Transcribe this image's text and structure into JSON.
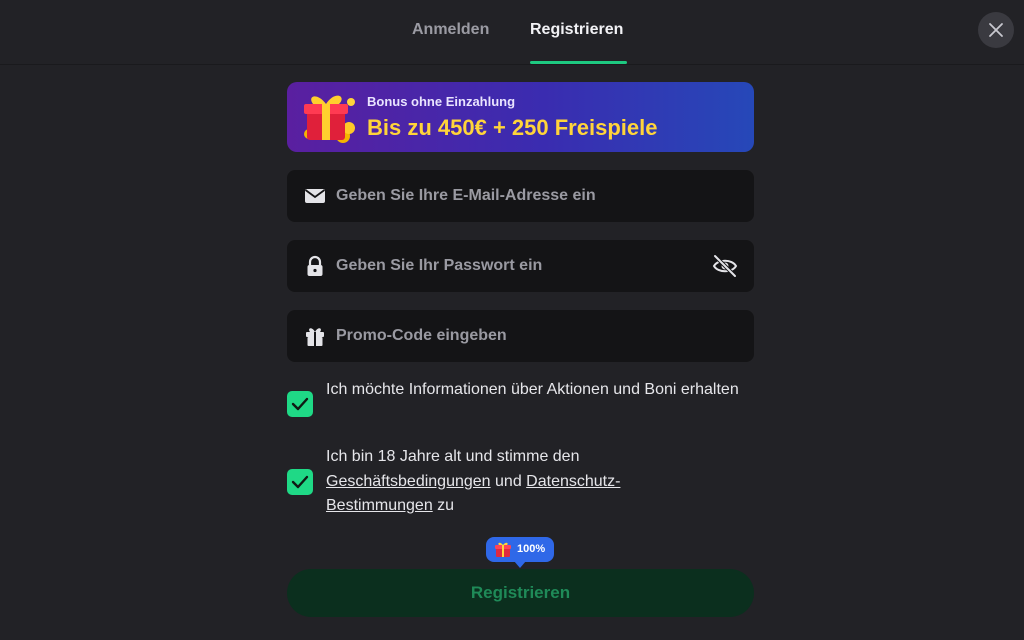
{
  "tabs": {
    "login": "Anmelden",
    "register": "Registrieren"
  },
  "banner": {
    "subtitle": "Bonus ohne Einzahlung",
    "title": "Bis zu 450€ + 250 Freispiele",
    "icon": "gift-box-icon"
  },
  "form": {
    "email": {
      "placeholder": "Geben Sie Ihre E-Mail-Adresse ein",
      "value": "",
      "icon": "envelope-icon"
    },
    "password": {
      "placeholder": "Geben Sie Ihr Passwort ein",
      "value": "",
      "icon": "lock-icon",
      "toggle_icon": "eye-off-icon"
    },
    "promo": {
      "placeholder": "Promo-Code eingeben",
      "value": "",
      "icon": "gift-icon"
    }
  },
  "consent": {
    "marketing": {
      "checked": true,
      "text": "Ich möchte Informationen über Aktionen und Boni erhalten"
    },
    "terms": {
      "checked": true,
      "text_before": "Ich bin 18 Jahre alt und stimme den ",
      "link_terms": "Geschäftsbedingungen",
      "text_and": " und ",
      "link_privacy_1": "Datenschutz-",
      "link_privacy_2": "Bestimmungen",
      "text_after": " zu"
    }
  },
  "progress_badge": {
    "text": "100%",
    "value": 100
  },
  "submit_label": "Registrieren",
  "colors": {
    "background": "#222226",
    "field_bg": "#141416",
    "accent_green": "#1fd986",
    "tab_underline": "#1ec981",
    "banner_title": "#ffd43a",
    "badge_bg": "#2f68e8",
    "submit_bg": "#0b2f1e",
    "submit_text": "#1f8a58"
  }
}
